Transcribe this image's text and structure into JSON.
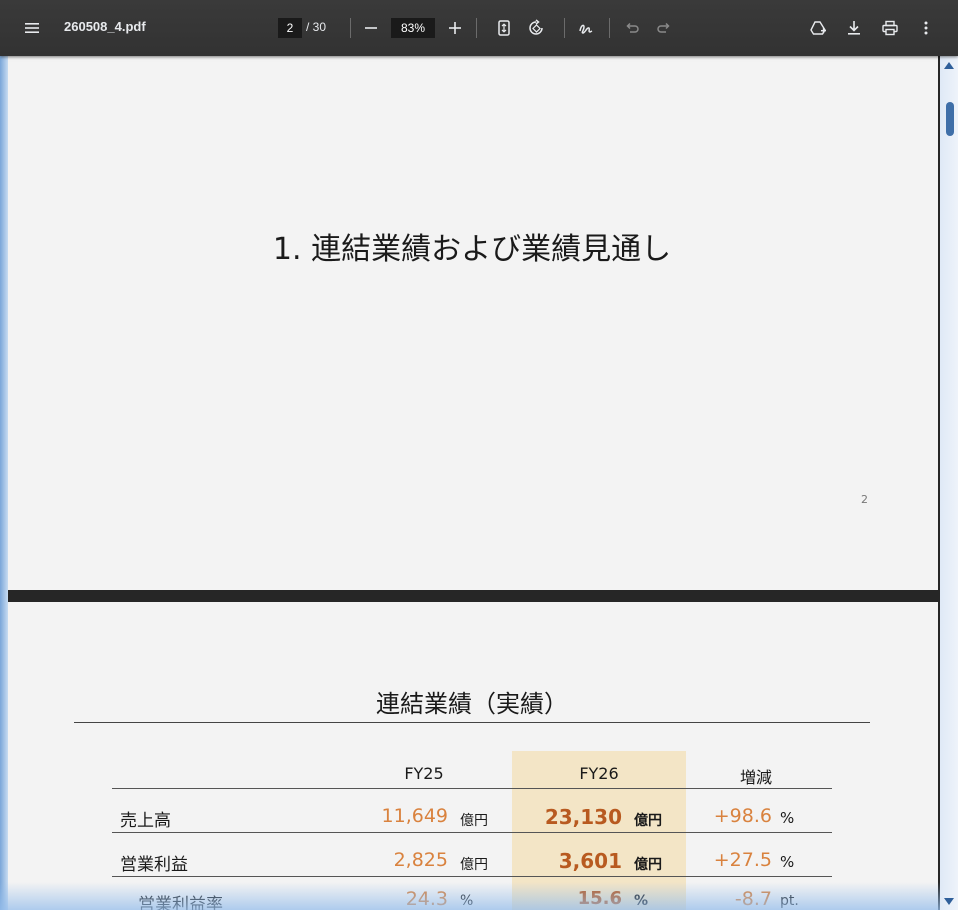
{
  "toolbar": {
    "file_name": "260508_4.pdf",
    "current_page": "2",
    "page_total": "/ 30",
    "zoom": "83%",
    "icons": [
      "menu-icon",
      "zoom-out-icon",
      "zoom-in-icon",
      "fit-page-icon",
      "rotate-icon",
      "draw-icon",
      "undo-icon",
      "redo-icon",
      "add-to-drive-icon",
      "download-icon",
      "print-icon",
      "more-icon"
    ]
  },
  "page1": {
    "heading": "1. 連結業績および業績見通し",
    "page_number": "2"
  },
  "page2": {
    "heading": "連結業績（実績）",
    "columns": [
      "FY25",
      "FY26",
      "増減"
    ],
    "rows": [
      {
        "label": "売上高",
        "fy25": "11,649",
        "fy25_unit": "億円",
        "fy26": "23,130",
        "fy26_unit": "億円",
        "change": "+98.6",
        "change_unit": "%"
      },
      {
        "label": "営業利益",
        "fy25": "2,825",
        "fy25_unit": "億円",
        "fy26": "3,601",
        "fy26_unit": "億円",
        "change": "+27.5",
        "change_unit": "%"
      },
      {
        "label": "営業利益率",
        "fy25": "24.3",
        "fy25_unit": "%",
        "fy26": "15.6",
        "fy26_unit": "%",
        "change": "-8.7",
        "change_unit": "pt."
      }
    ],
    "colors": {
      "value_orange": "#d9823e",
      "value_bold": "#b85a20",
      "highlight": "#f3e5c6"
    }
  }
}
